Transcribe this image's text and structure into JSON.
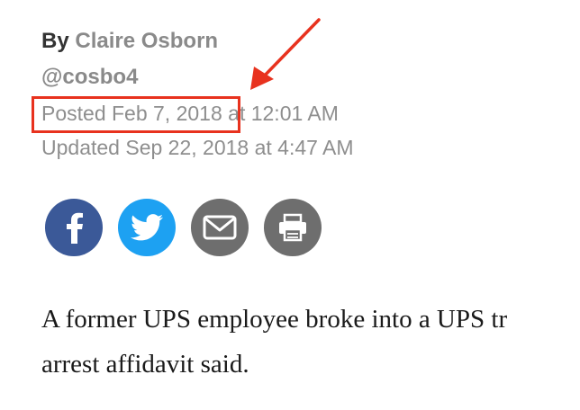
{
  "byline": {
    "prefix": "By",
    "author": "Claire Osborn",
    "handle": "@cosbo4"
  },
  "dates": {
    "posted": "Posted Feb 7, 2018 at 12:01 AM",
    "updated": "Updated Sep 22, 2018 at 4:47 AM"
  },
  "share": [
    {
      "name": "facebook",
      "icon": "facebook-icon",
      "color": "#3b5998"
    },
    {
      "name": "twitter",
      "icon": "twitter-icon",
      "color": "#1da1f2"
    },
    {
      "name": "email",
      "icon": "envelope-icon",
      "color": "#6e6e6e"
    },
    {
      "name": "print",
      "icon": "printer-icon",
      "color": "#6e6e6e"
    }
  ],
  "annotation": {
    "box_color": "#e8321e",
    "arrow_color": "#e8321e"
  },
  "article": {
    "line1": "A former UPS employee broke into a UPS tr",
    "line2": "arrest affidavit said."
  }
}
